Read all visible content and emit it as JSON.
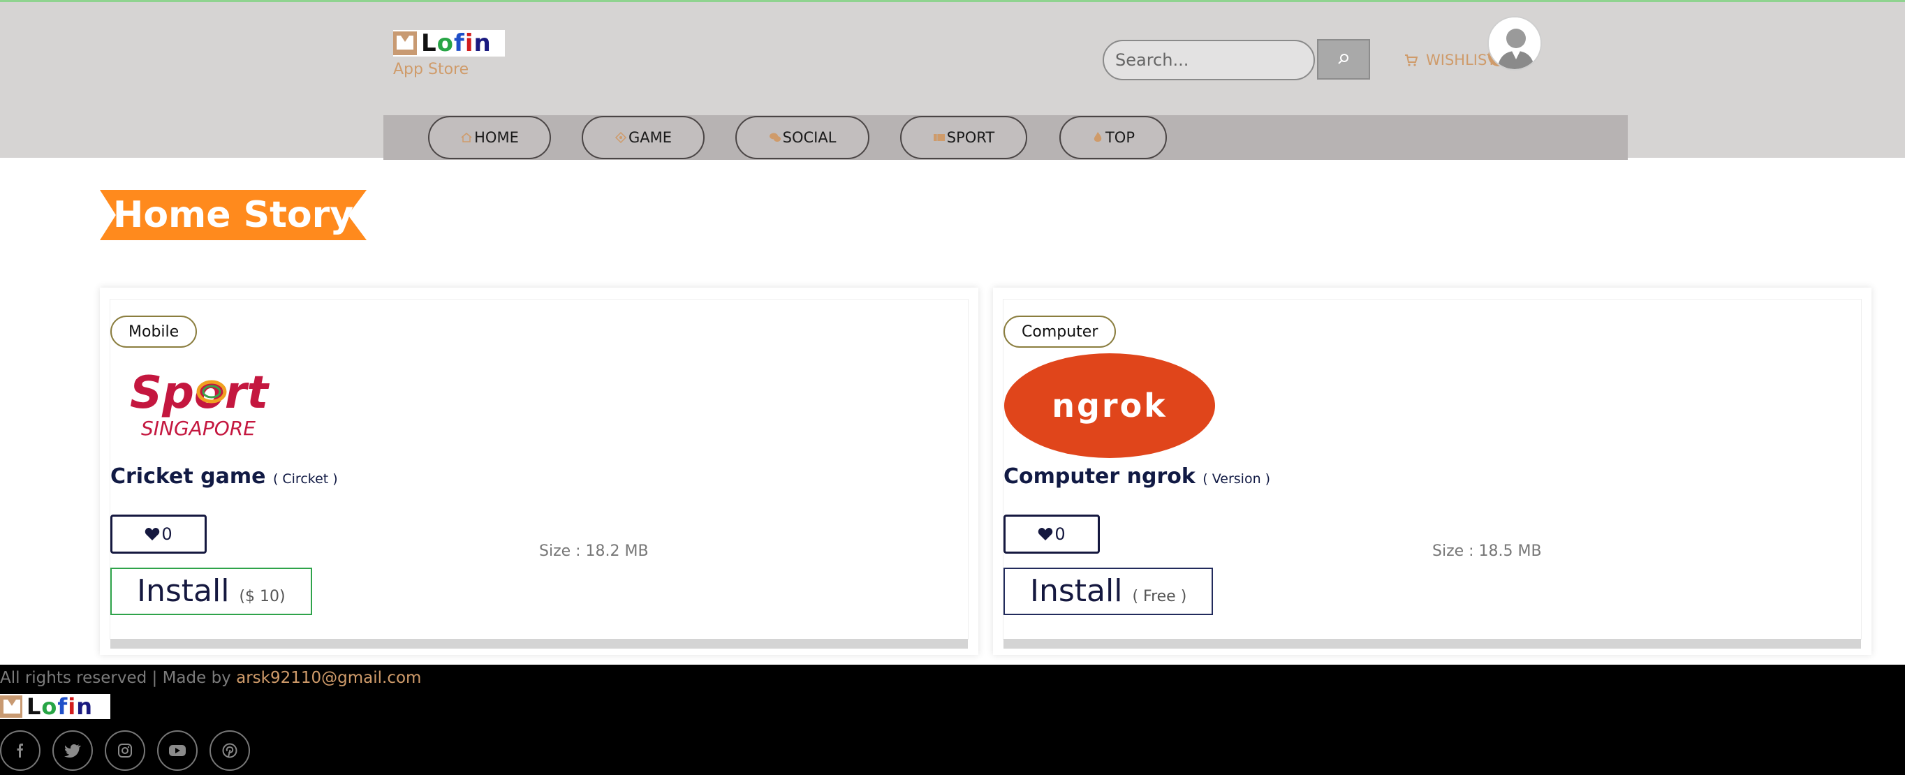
{
  "header": {
    "brand": {
      "letters": [
        "L",
        "o",
        "f",
        "i",
        "n"
      ],
      "subtitle": "App Store"
    },
    "search": {
      "placeholder": "Search...",
      "icon": "search-icon"
    },
    "wishlist": {
      "label": "WISHLIST",
      "icon": "cart-icon"
    },
    "avatar": {
      "icon": "user-avatar"
    },
    "nav": [
      {
        "label": "HOME",
        "icon": "home-icon"
      },
      {
        "label": "GAME",
        "icon": "game-icon"
      },
      {
        "label": "SOCIAL",
        "icon": "chat-icon"
      },
      {
        "label": "SPORT",
        "icon": "ticket-icon"
      },
      {
        "label": "TOP",
        "icon": "fire-icon"
      }
    ],
    "menu_icon": "hamburger-icon"
  },
  "main": {
    "section_title": "Home Story",
    "cards": [
      {
        "tag": "Mobile",
        "image_text": {
          "line1": "Sport",
          "line2": "SINGAPORE"
        },
        "title": "Cricket game",
        "subtitle": "( Circket )",
        "likes": "0",
        "size": "Size : 18.2 MB",
        "install_label": "Install",
        "price": "($ 10)"
      },
      {
        "tag": "Computer",
        "image_text": {
          "line1": "ngrok"
        },
        "title": "Computer ngrok",
        "subtitle": "( Version )",
        "likes": "0",
        "size": "Size : 18.5 MB",
        "install_label": "Install",
        "price": "( Free )"
      }
    ]
  },
  "footer": {
    "copyright": "All rights reserved | Made by",
    "email": "arsk92110@gmail.com",
    "social": [
      "facebook-icon",
      "twitter-icon",
      "instagram-icon",
      "youtube-icon",
      "pinterest-icon"
    ]
  },
  "colors": {
    "header_bg": "#d6d4d3",
    "navbar_bg": "#b7b3b3",
    "accent": "#cf9b6a",
    "ribbon": "#ff8a1d",
    "footer_bg": "#000000",
    "title_text": "#111a44"
  }
}
